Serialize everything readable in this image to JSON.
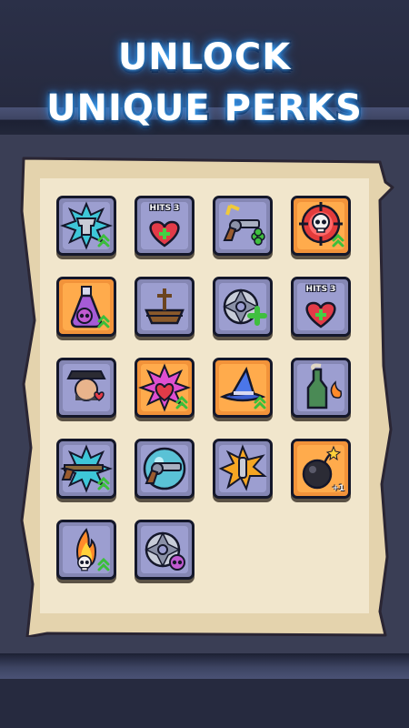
{
  "header": {
    "title_line1": "UNLOCK",
    "title_line2": "UNIQUE PERKS"
  },
  "colors": {
    "tile_purple": "#8587b4",
    "tile_orange": "#f2933a",
    "parchment": "#efe2c6",
    "background": "#2a2f45"
  },
  "perks": [
    {
      "icon": "armor-burst-upgrade-icon",
      "tile": "purple"
    },
    {
      "icon": "heart-plus-icon",
      "tile": "purple",
      "label": "HITS 3"
    },
    {
      "icon": "revolver-clover-icon",
      "tile": "purple"
    },
    {
      "icon": "skull-target-upgrade-icon",
      "tile": "orange"
    },
    {
      "icon": "poison-potion-upgrade-icon",
      "tile": "orange"
    },
    {
      "icon": "pirate-ship-icon",
      "tile": "purple"
    },
    {
      "icon": "shuriken-plus-icon",
      "tile": "purple"
    },
    {
      "icon": "heart-plus-icon",
      "tile": "purple",
      "label": "HITS 3"
    },
    {
      "icon": "bandit-heart-icon",
      "tile": "purple"
    },
    {
      "icon": "heart-burst-upgrade-icon",
      "tile": "orange"
    },
    {
      "icon": "wizard-hat-upgrade-icon",
      "tile": "orange"
    },
    {
      "icon": "bottle-fire-icon",
      "tile": "purple"
    },
    {
      "icon": "rifle-burst-upgrade-icon",
      "tile": "purple"
    },
    {
      "icon": "revolver-bubble-icon",
      "tile": "purple"
    },
    {
      "icon": "bullet-explosion-icon",
      "tile": "purple"
    },
    {
      "icon": "bomb-plus-one-icon",
      "tile": "orange",
      "label": "+1"
    },
    {
      "icon": "fire-skull-upgrade-icon",
      "tile": "purple"
    },
    {
      "icon": "shuriken-skull-icon",
      "tile": "purple"
    }
  ]
}
